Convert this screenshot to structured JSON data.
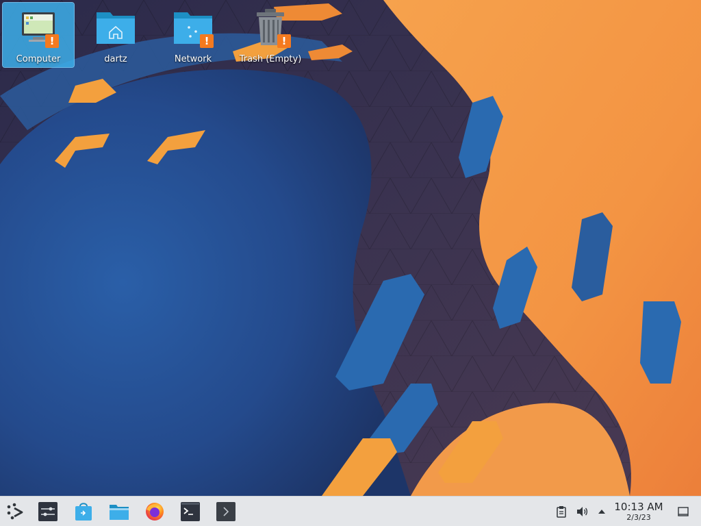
{
  "desktop": {
    "icons": [
      {
        "label": "Computer",
        "icon": "computer-icon",
        "selected": true,
        "warning": true
      },
      {
        "label": "dartz",
        "icon": "home-folder-icon",
        "selected": false,
        "warning": false
      },
      {
        "label": "Network",
        "icon": "network-folder-icon",
        "selected": false,
        "warning": true
      },
      {
        "label": "Trash (Empty)",
        "icon": "trash-icon",
        "selected": false,
        "warning": true
      }
    ]
  },
  "taskbar": {
    "launchers": [
      {
        "name": "application-launcher",
        "icon": "kde-launcher-icon"
      },
      {
        "name": "system-settings",
        "icon": "settings-sliders-icon"
      },
      {
        "name": "discover",
        "icon": "discover-store-icon"
      },
      {
        "name": "file-manager",
        "icon": "folder-icon"
      },
      {
        "name": "firefox",
        "icon": "firefox-icon"
      },
      {
        "name": "terminal",
        "icon": "terminal-icon"
      },
      {
        "name": "konsole",
        "icon": "chevron-right-icon"
      }
    ],
    "tray": {
      "clipboard_icon": "clipboard-icon",
      "volume_icon": "speaker-icon",
      "expand_icon": "arrow-up-icon",
      "show_desktop_icon": "show-desktop-icon"
    },
    "clock": {
      "time": "10:13 AM",
      "date": "2/3/23"
    }
  },
  "colors": {
    "accent": "#3daee9",
    "warning": "#f47a1f",
    "wallpaper_orange": "#f39443",
    "wallpaper_blue": "#2a6ab0",
    "panel": "#e4e6e9"
  }
}
